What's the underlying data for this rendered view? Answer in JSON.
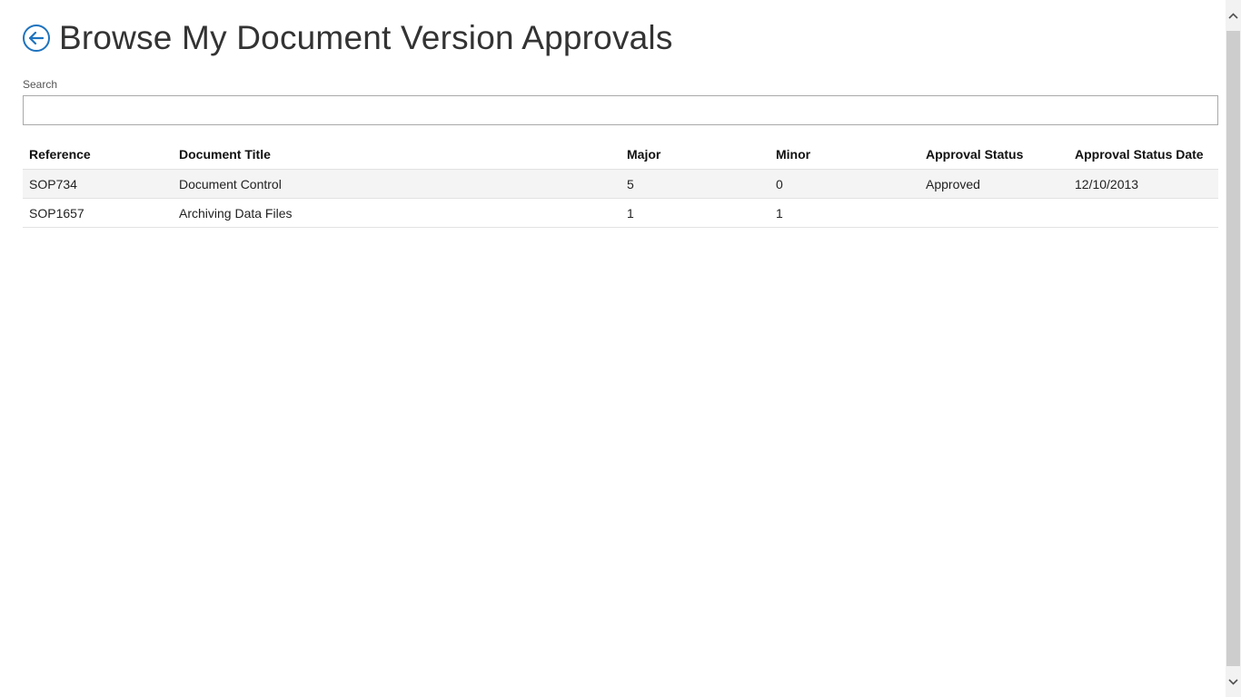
{
  "header": {
    "title": "Browse My Document Version Approvals",
    "back_icon": "arrow-left-circle-icon",
    "accent_color": "#1e73be"
  },
  "search": {
    "label": "Search",
    "value": "",
    "placeholder": ""
  },
  "table": {
    "columns": [
      "Reference",
      "Document Title",
      "Major",
      "Minor",
      "Approval Status",
      "Approval Status Date"
    ],
    "rows": [
      {
        "reference": "SOP734",
        "title": "Document Control",
        "major": "5",
        "minor": "0",
        "status": "Approved",
        "status_date": "12/10/2013"
      },
      {
        "reference": "SOP1657",
        "title": "Archiving Data Files",
        "major": "1",
        "minor": "1",
        "status": "",
        "status_date": ""
      }
    ]
  },
  "scrollbar": {
    "up_icon": "chevron-up-icon",
    "down_icon": "chevron-down-icon"
  }
}
